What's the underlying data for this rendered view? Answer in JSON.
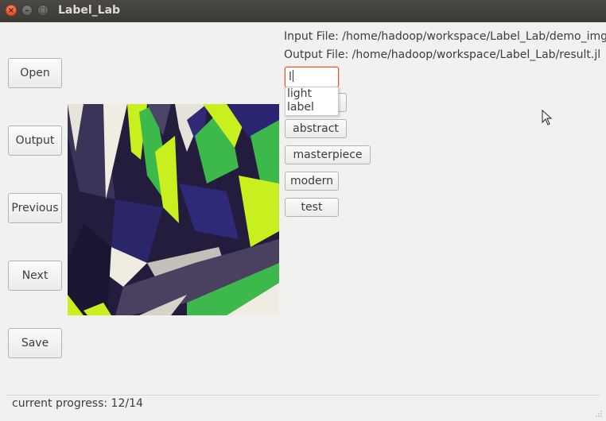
{
  "window": {
    "title": "Label_Lab",
    "close_glyph": "×",
    "min_glyph": "–",
    "max_glyph": "□"
  },
  "sidebar": {
    "open_label": "Open",
    "output_label": "Output",
    "previous_label": "Previous",
    "next_label": "Next",
    "save_label": "Save"
  },
  "info": {
    "input_file": "Input File: /home/hadoop/workspace/Label_Lab/demo_img",
    "output_file": "Output File: /home/hadoop/workspace/Label_Lab/result.jl"
  },
  "label_entry": {
    "value": "l"
  },
  "suggestions": [
    "light",
    "label"
  ],
  "tags": [
    "abstract",
    "masterpiece",
    "modern",
    "test"
  ],
  "status": {
    "progress_text": "current progress: 12/14"
  },
  "colors": {
    "accent_focus": "#e0592a",
    "image_dark": "#231c3d",
    "image_lime": "#c8f01e",
    "image_green": "#3db84a",
    "image_navy": "#2e2a78"
  }
}
